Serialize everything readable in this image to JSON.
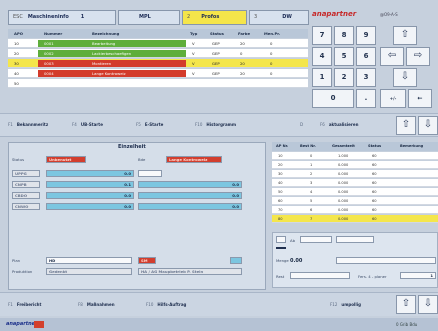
{
  "tabs": [
    {
      "key": "ESC",
      "label": "Maschineninfo",
      "key2": "1"
    },
    {
      "key": "",
      "label": "MPL"
    },
    {
      "key": "2",
      "label": "Profos"
    },
    {
      "key": "3",
      "label": "DW"
    }
  ],
  "brand": {
    "logo": "anapartner",
    "small": "@O9-A-S"
  },
  "grid": {
    "headers": [
      "APO",
      "Nummer",
      "Bezeichnung",
      "Typ",
      "Status",
      "Farbe",
      "Men.Pr."
    ],
    "rows": [
      {
        "apo": "10",
        "nummer": "0001",
        "bez": "Bearbeitung",
        "typ": "V",
        "status": "GEP",
        "farbe": "20",
        "men": "0",
        "color": "#5fae3b",
        "sel": false
      },
      {
        "apo": "20",
        "nummer": "0002",
        "bez": "Lackierbeschaefigen",
        "typ": "V",
        "status": "GEP",
        "farbe": "0",
        "men": "0",
        "color": "#5fae3b",
        "sel": false
      },
      {
        "apo": "30",
        "nummer": "0003",
        "bez": "Montieren",
        "typ": "V",
        "status": "GEP",
        "farbe": "20",
        "men": "0",
        "color": "#d33b2b",
        "sel": true
      },
      {
        "apo": "40",
        "nummer": "0004",
        "bez": "Lange Kontroweiz",
        "typ": "V",
        "status": "GEP",
        "farbe": "20",
        "men": "0",
        "color": "#d33b2b",
        "sel": false
      },
      {
        "apo": "50",
        "nummer": "",
        "bez": "",
        "typ": "",
        "status": "",
        "farbe": "",
        "men": "",
        "color": "#ffffff",
        "sel": false
      }
    ]
  },
  "keypad": {
    "keys": [
      "7",
      "8",
      "9",
      "4",
      "5",
      "6",
      "1",
      "2",
      "3",
      "0",
      "."
    ],
    "extra": "+/-"
  },
  "fkeys_top": [
    {
      "k": "F1",
      "label": "Bekannmeritz"
    },
    {
      "k": "F4",
      "label": "UB-Starte"
    },
    {
      "k": "F5",
      "label": "E-Starte"
    },
    {
      "k": "F10",
      "label": "Historgramm"
    },
    {
      "k": "D",
      "label": ""
    },
    {
      "k": "F6",
      "label": "aktualisieren"
    }
  ],
  "einzelheit": {
    "title": "Einzelheit",
    "status_label": "Status",
    "status_value": "Unbenutzt",
    "bde_label": "Bde",
    "bde_value": "Lange Kontroweiz",
    "rows": [
      {
        "label": "UPPG",
        "a": "0.0",
        "b": ""
      },
      {
        "label": "CNPB",
        "a": "0.1",
        "b": "0.0"
      },
      {
        "label": "CBDO",
        "a": "0.0",
        "b": "0.0"
      },
      {
        "label": "CNWO",
        "a": "0.0",
        "b": "0.0"
      }
    ],
    "plan_label": "Plan",
    "plan_value": "HD",
    "prod_label": "Produktion",
    "prod_value": "Gedenkt",
    "sm_label": "SM",
    "sm_value": "HA / AG Maupbetrieb P. Stein"
  },
  "right_table": {
    "headers": [
      "AP Nr.",
      "Best Nr.",
      "Gesamtzeit",
      "Status",
      "Bemerkung"
    ],
    "rows": [
      {
        "ap": "10",
        "best": "0",
        "ges": "1.000",
        "st": "60"
      },
      {
        "ap": "20",
        "best": "1",
        "ges": "0.000",
        "st": "60"
      },
      {
        "ap": "30",
        "best": "2",
        "ges": "0.000",
        "st": "60"
      },
      {
        "ap": "40",
        "best": "3",
        "ges": "0.000",
        "st": "60"
      },
      {
        "ap": "50",
        "best": "4",
        "ges": "0.000",
        "st": "60"
      },
      {
        "ap": "60",
        "best": "5",
        "ges": "0.000",
        "st": "60"
      },
      {
        "ap": "70",
        "best": "6",
        "ges": "0.000",
        "st": "60"
      },
      {
        "ap": "80",
        "best": "7",
        "ges": "0.000",
        "st": "60"
      }
    ],
    "sel_index": 7
  },
  "detail": {
    "a_label": "Ab",
    "a_val": "0.00",
    "menge_label": "Menge",
    "rest_label": "Rest",
    "pos_label": "Fers. 4 - planer",
    "pos_value": "1"
  },
  "fkeys_bottom": [
    {
      "k": "F1",
      "label": "Freibericht"
    },
    {
      "k": "F8",
      "label": "Maßnahmen"
    },
    {
      "k": "F10",
      "label": "Hilfs-Auftrag"
    },
    {
      "k": "F12",
      "label": "umpollig"
    }
  ],
  "status_bar": {
    "logo": "anapartner",
    "right": "0 Grib Bdu"
  }
}
